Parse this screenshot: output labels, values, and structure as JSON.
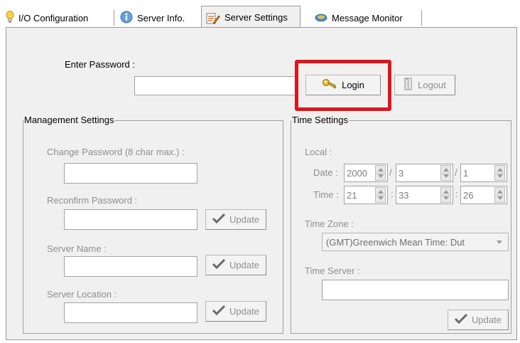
{
  "tabs": [
    {
      "label": "I/O Configuration",
      "icon": "lightbulb-icon"
    },
    {
      "label": "Server Info.",
      "icon": "info-icon"
    },
    {
      "label": "Server Settings",
      "icon": "settings-edit-icon"
    },
    {
      "label": "Message Monitor",
      "icon": "monitor-icon"
    }
  ],
  "active_tab": "Server Settings",
  "login": {
    "password_label": "Enter Password :",
    "password_value": "",
    "login_label": "Login",
    "logout_label": "Logout",
    "highlight_color": "#e0141b"
  },
  "management": {
    "title": "Management Settings",
    "change_password_label": "Change Password (8 char max.) :",
    "reconfirm_label": "Reconfirm Password :",
    "server_name_label": "Server Name :",
    "server_location_label": "Server Location :",
    "update_label": "Update"
  },
  "time": {
    "title": "Time Settings",
    "local_label": "Local :",
    "date_label": "Date :",
    "time_label": "Time :",
    "date": {
      "year": "2000",
      "month": "3",
      "day": "1",
      "separator": "/"
    },
    "clock": {
      "hour": "21",
      "minute": "33",
      "second": "26",
      "separator": ":"
    },
    "timezone_label": "Time Zone :",
    "timezone_value": "(GMT)Greenwich Mean Time: Dut",
    "time_server_label": "Time Server :",
    "update_label": "Update"
  }
}
